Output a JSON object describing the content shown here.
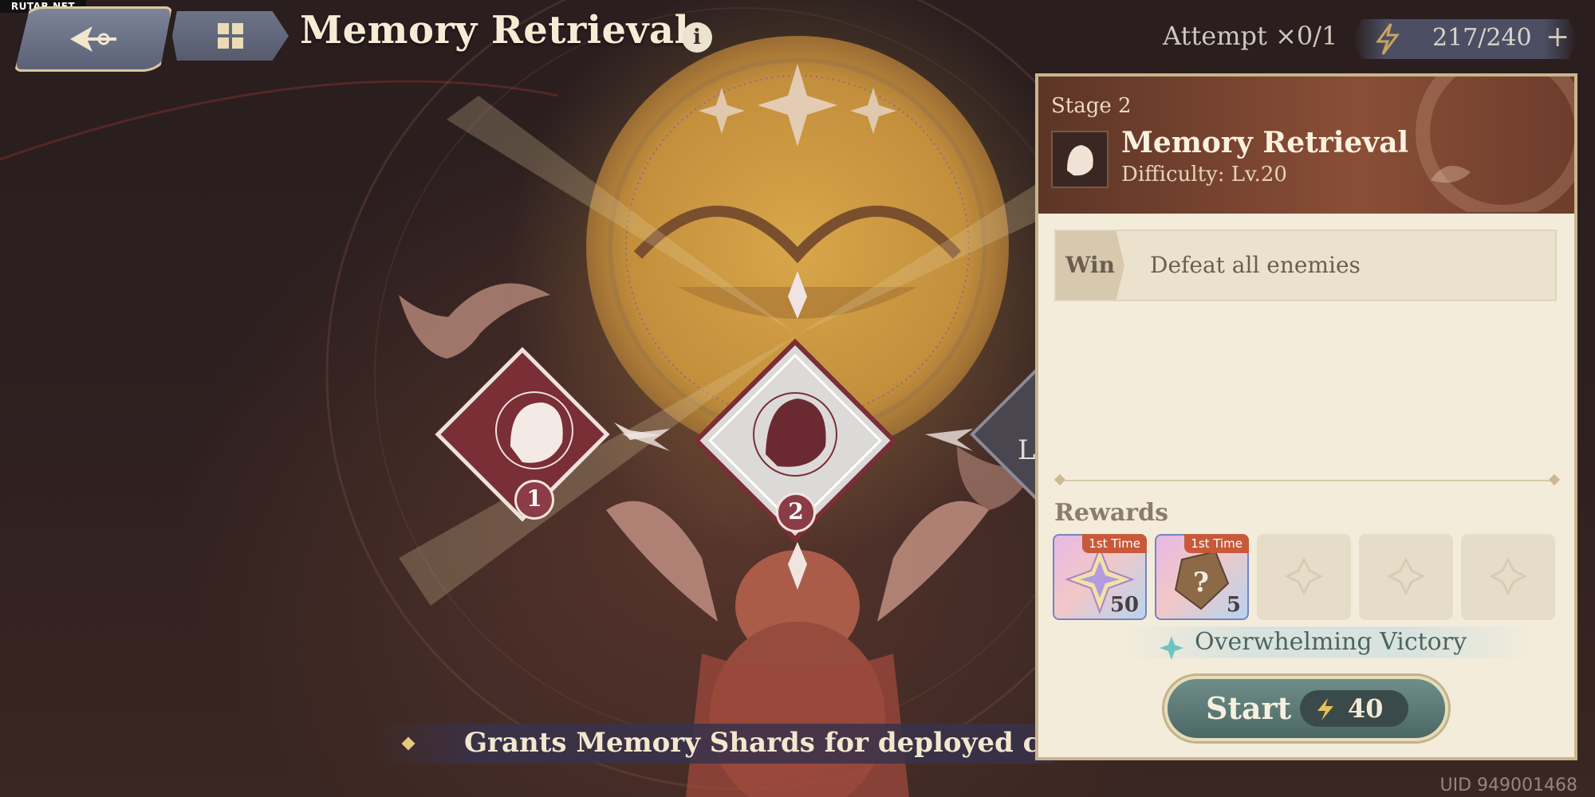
{
  "watermark": "RUTAB.NET",
  "header": {
    "title": "Memory Retrieval",
    "info_icon": "i",
    "attempt": "Attempt ×0/1",
    "stamina": "217/240",
    "stamina_add": "+"
  },
  "map": {
    "nodes": [
      {
        "number": "1"
      },
      {
        "number": "2"
      }
    ],
    "partial_node_text": "L"
  },
  "banner": {
    "text": "Grants Memory Shards for deployed cha"
  },
  "uid": "UID 949001468",
  "panel": {
    "stage": "Stage 2",
    "title": "Memory Retrieval",
    "difficulty": "Difficulty: Lv.20",
    "win_tag": "Win",
    "win_condition": "Defeat all enemies",
    "rewards_label": "Rewards",
    "rewards": [
      {
        "tag": "1st Time",
        "count": "50",
        "icon": "star-crystal-icon"
      },
      {
        "tag": "1st Time",
        "count": "5",
        "icon": "mystery-shard-icon"
      }
    ],
    "victory": "Overwhelming Victory",
    "start_label": "Start",
    "start_cost": "40"
  },
  "colors": {
    "panel_bg": "#f4ecdb",
    "header_brown": "#8a4e36",
    "start_teal": "#5f7d7a",
    "node_red": "#7a2e36",
    "title_cream": "#f6ecd6"
  }
}
